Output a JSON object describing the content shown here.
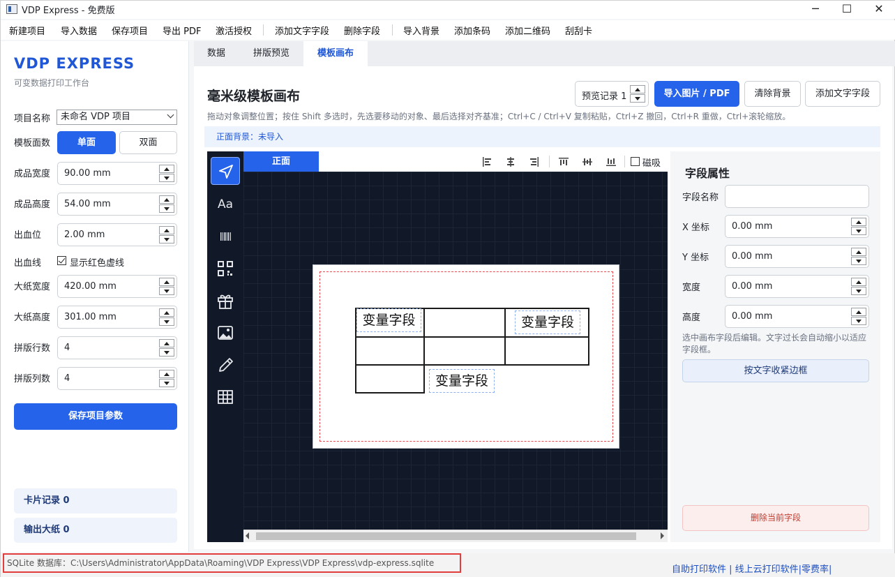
{
  "window": {
    "title": "VDP Express - 免费版",
    "minimize": "─",
    "maximize": "☐",
    "close": "✕"
  },
  "menu": [
    "新建项目",
    "导入数据",
    "保存项目",
    "导出 PDF",
    "激活授权",
    "添加文字字段",
    "删除字段",
    "导入背景",
    "添加条码",
    "添加二维码",
    "刮刮卡"
  ],
  "sidebar": {
    "brand": "VDP EXPRESS",
    "subtitle": "可变数据打印工作台",
    "project_label": "项目名称",
    "project_value": "未命名 VDP 项目",
    "sides_label": "模板面数",
    "single": "单面",
    "double": "双面",
    "fields": [
      {
        "label": "成品宽度",
        "value": "90.00 mm"
      },
      {
        "label": "成品高度",
        "value": "54.00 mm"
      },
      {
        "label": "出血位",
        "value": "2.00 mm"
      }
    ],
    "bleed_line_label": "出血线",
    "show_bleed": "显示红色虚线",
    "fields2": [
      {
        "label": "大纸宽度",
        "value": "420.00 mm"
      },
      {
        "label": "大纸高度",
        "value": "301.00 mm"
      },
      {
        "label": "拼版行数",
        "value": "4"
      },
      {
        "label": "拼版列数",
        "value": "4"
      }
    ],
    "save_params": "保存项目参数",
    "card_records": "卡片记录  0",
    "output_sheets": "输出大纸  0"
  },
  "tabs": [
    "数据",
    "拼版预览",
    "模板画布"
  ],
  "main": {
    "title": "毫米级模板画布",
    "hint": "拖动对象调整位置；按住 Shift 多选时，先选要移动的对象、最后选择对齐基准；Ctrl+C / Ctrl+V 复制粘贴，Ctrl+Z 撤回，Ctrl+R 重做，Ctrl+滚轮缩放。",
    "bg_status": "正面背景：未导入",
    "preview_record": "预览记录 1",
    "import_image": "导入图片 / PDF",
    "clear_bg": "清除背景",
    "add_text": "添加文字字段",
    "face_tab": "正面",
    "snap": "磁吸",
    "text_tool": "Aa",
    "var_field": "变量字段"
  },
  "props": {
    "title": "字段属性",
    "name_label": "字段名称",
    "name_value": "",
    "x_label": "X 坐标",
    "x_value": "0.00 mm",
    "y_label": "Y 坐标",
    "y_value": "0.00 mm",
    "w_label": "宽度",
    "w_value": "0.00 mm",
    "h_label": "高度",
    "h_value": "0.00 mm",
    "note": "选中画布字段后编辑。文字过长会自动缩小以适应字段框。",
    "shrink": "按文字收紧边框",
    "delete": "删除当前字段"
  },
  "status": {
    "db_path": "SQLite 数据库：C:\\Users\\Administrator\\AppData\\Roaming\\VDP Express\\VDP Express\\vdp-express.sqlite",
    "links": "自助打印软件 | 线上云打印软件|零费率|"
  }
}
